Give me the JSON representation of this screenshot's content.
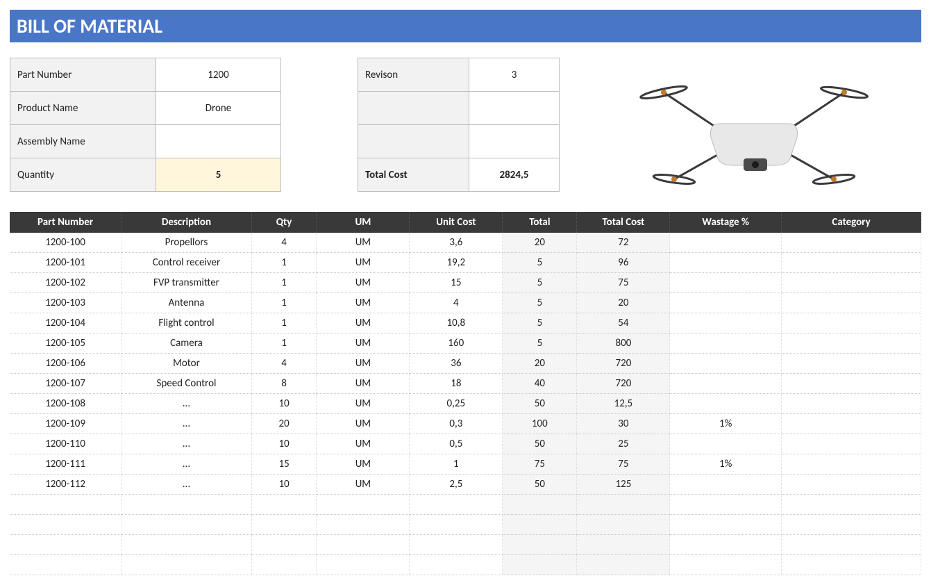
{
  "title": "BILL OF MATERIAL",
  "info1": {
    "rows": [
      {
        "label": "Part Number",
        "value": "1200"
      },
      {
        "label": "Product Name",
        "value": "Drone"
      },
      {
        "label": "Assembly Name",
        "value": ""
      },
      {
        "label": "Quantity",
        "value": "5"
      }
    ]
  },
  "info2": {
    "rows": [
      {
        "label": "Revison",
        "value": "3"
      },
      {
        "label": "",
        "value": ""
      },
      {
        "label": "",
        "value": ""
      },
      {
        "label": "Total Cost",
        "value": "2824,5"
      }
    ]
  },
  "headers": {
    "part": "Part Number",
    "desc": "Description",
    "qty": "Qty",
    "um": "UM",
    "ucost": "Unit Cost",
    "total": "Total",
    "tcost": "Total Cost",
    "wast": "Wastage %",
    "cat": "Category"
  },
  "rows": [
    {
      "part": "1200-100",
      "desc": "Propellors",
      "qty": "4",
      "um": "UM",
      "ucost": "3,6",
      "total": "20",
      "tcost": "72",
      "wast": "",
      "cat": ""
    },
    {
      "part": "1200-101",
      "desc": "Control receiver",
      "qty": "1",
      "um": "UM",
      "ucost": "19,2",
      "total": "5",
      "tcost": "96",
      "wast": "",
      "cat": ""
    },
    {
      "part": "1200-102",
      "desc": "FVP transmitter",
      "qty": "1",
      "um": "UM",
      "ucost": "15",
      "total": "5",
      "tcost": "75",
      "wast": "",
      "cat": ""
    },
    {
      "part": "1200-103",
      "desc": "Antenna",
      "qty": "1",
      "um": "UM",
      "ucost": "4",
      "total": "5",
      "tcost": "20",
      "wast": "",
      "cat": ""
    },
    {
      "part": "1200-104",
      "desc": "Flight control",
      "qty": "1",
      "um": "UM",
      "ucost": "10,8",
      "total": "5",
      "tcost": "54",
      "wast": "",
      "cat": ""
    },
    {
      "part": "1200-105",
      "desc": "Camera",
      "qty": "1",
      "um": "UM",
      "ucost": "160",
      "total": "5",
      "tcost": "800",
      "wast": "",
      "cat": ""
    },
    {
      "part": "1200-106",
      "desc": "Motor",
      "qty": "4",
      "um": "UM",
      "ucost": "36",
      "total": "20",
      "tcost": "720",
      "wast": "",
      "cat": ""
    },
    {
      "part": "1200-107",
      "desc": "Speed Control",
      "qty": "8",
      "um": "UM",
      "ucost": "18",
      "total": "40",
      "tcost": "720",
      "wast": "",
      "cat": ""
    },
    {
      "part": "1200-108",
      "desc": "...",
      "qty": "10",
      "um": "UM",
      "ucost": "0,25",
      "total": "50",
      "tcost": "12,5",
      "wast": "",
      "cat": ""
    },
    {
      "part": "1200-109",
      "desc": "...",
      "qty": "20",
      "um": "UM",
      "ucost": "0,3",
      "total": "100",
      "tcost": "30",
      "wast": "1%",
      "cat": ""
    },
    {
      "part": "1200-110",
      "desc": "...",
      "qty": "10",
      "um": "UM",
      "ucost": "0,5",
      "total": "50",
      "tcost": "25",
      "wast": "",
      "cat": ""
    },
    {
      "part": "1200-111",
      "desc": "...",
      "qty": "15",
      "um": "UM",
      "ucost": "1",
      "total": "75",
      "tcost": "75",
      "wast": "1%",
      "cat": ""
    },
    {
      "part": "1200-112",
      "desc": "...",
      "qty": "10",
      "um": "UM",
      "ucost": "2,5",
      "total": "50",
      "tcost": "125",
      "wast": "",
      "cat": ""
    }
  ],
  "empty_rows": 4
}
